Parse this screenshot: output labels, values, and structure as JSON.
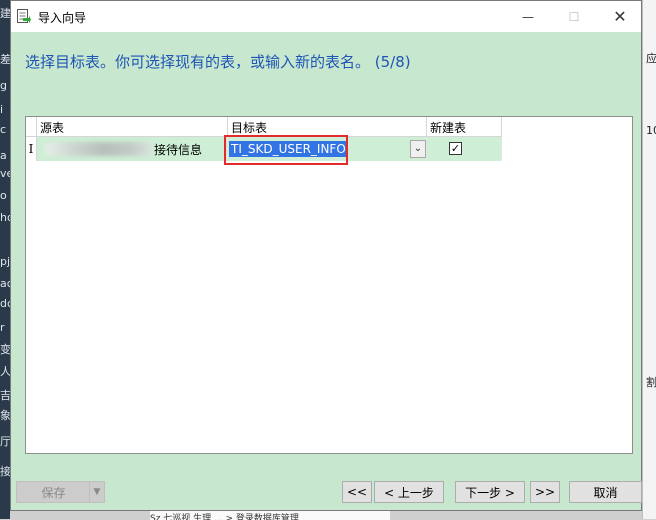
{
  "window": {
    "title": "导入向导",
    "minimize_glyph": "—",
    "maximize_glyph": "☐",
    "close_glyph": "✕"
  },
  "instruction": "选择目标表。你可选择现有的表，或输入新的表名。 (5/8)",
  "grid": {
    "columns": [
      "源表",
      "目标表",
      "新建表"
    ],
    "rows": [
      {
        "indicator": "I",
        "source_table_suffix": "接待信息",
        "target_table": "TI_SKD_USER_INFO",
        "new_table_checked": true,
        "checkmark": "✓",
        "dropdown_glyph": "⌄"
      }
    ]
  },
  "buttons": {
    "save": "保存",
    "save_dropdown": "▼",
    "first": "<<",
    "prev": "< 上一步",
    "next": "下一步 >",
    "last": ">>",
    "cancel": "取消"
  },
  "background": {
    "left_strip_chars": [
      "建",
      "差",
      "g",
      "i",
      "c",
      "a",
      "ve",
      "o",
      "ho",
      "pj",
      "ac",
      "dc",
      "r",
      "变",
      "人",
      "吉",
      "象",
      "厅",
      "接"
    ],
    "right_strip_chars": [
      "应",
      "10",
      "割"
    ],
    "bottom_text": "Sz 七巡视 生理 ... > 登录数据库管理"
  },
  "colors": {
    "dialog_bg": "#c7e8cf",
    "instruction_text": "#1f55b4",
    "selection": "#3374e5",
    "highlight_box": "#e32b2b"
  }
}
